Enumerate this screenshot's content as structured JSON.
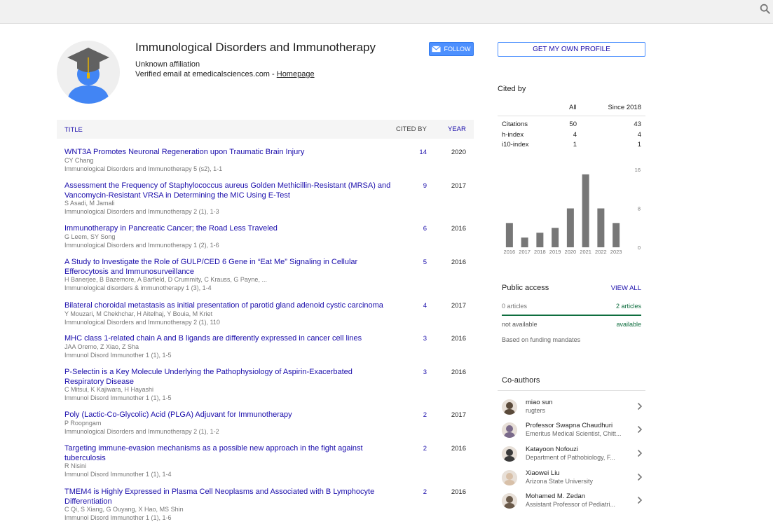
{
  "profile": {
    "name": "Immunological Disorders and Immunotherapy",
    "affiliation": "Unknown affiliation",
    "email_text": "Verified email at emedicalsciences.com - ",
    "homepage_link": "Homepage"
  },
  "buttons": {
    "follow": "FOLLOW",
    "get_profile": "GET MY OWN PROFILE"
  },
  "table": {
    "col_title": "TITLE",
    "col_cited": "CITED BY",
    "col_year": "YEAR",
    "rows": [
      {
        "title": "WNT3A Promotes Neuronal Regeneration upon Traumatic Brain Injury",
        "authors": "CY Chang",
        "venue": "Immunological Disorders and Immunotherapy 5 (s2), 1-1",
        "cited": "14",
        "year": "2020"
      },
      {
        "title": "Assessment the Frequency of Staphylococcus aureus Golden Methicillin-Resistant (MRSA) and Vancomycin-Resistant VRSA in Determining the MIC Using E-Test",
        "authors": "S Asadi, M Jamali",
        "venue": "Immunological Disorders and Immunotherapy 2 (1), 1-3",
        "cited": "9",
        "year": "2017"
      },
      {
        "title": "Immunotherapy in Pancreatic Cancer; the Road Less Traveled",
        "authors": "G Leem, SY Song",
        "venue": "Immunological Disorders and Immunotherapy 1 (2), 1-6",
        "cited": "6",
        "year": "2016"
      },
      {
        "title": "A Study to Investigate the Role of GULP/CED 6 Gene in “Eat Me” Signaling in Cellular Efferocytosis and Immunosurveillance",
        "authors": "H Banerjee, B Bazemore, A Barfield, D Crummity, C Krauss, G Payne, ...",
        "venue": "Immunological disorders & immunotherapy 1 (3), 1-4",
        "cited": "5",
        "year": "2016"
      },
      {
        "title": "Bilateral choroidal metastasis as initial presentation of parotid gland adenoid cystic carcinoma",
        "authors": "Y Mouzari, M Chekhchar, H Aitelhaj, Y Bouia, M Kriet",
        "venue": "Immunological Disorders and Immunotherapy 2 (1), 110",
        "cited": "4",
        "year": "2017"
      },
      {
        "title": "MHC class 1-related chain A and B ligands are differently expressed in cancer cell lines",
        "authors": "JAA Oremo, Z Xiao, Z Sha",
        "venue": "Immunol Disord Immunother 1 (1), 1-5",
        "cited": "3",
        "year": "2016"
      },
      {
        "title": "P-Selectin is a Key Molecule Underlying the Pathophysiology of Aspirin-Exacerbated Respiratory Disease",
        "authors": "C Mitsui, K Kajiwara, H Hayashi",
        "venue": "Immunol Disord Immunother 1 (1), 1-5",
        "cited": "3",
        "year": "2016"
      },
      {
        "title": "Poly (Lactic-Co-Glycolic) Acid (PLGA) Adjuvant for Immunotherapy",
        "authors": "P Roopngam",
        "venue": "Immunological Disorders and Immunotherapy 2 (1), 1-2",
        "cited": "2",
        "year": "2017"
      },
      {
        "title": "Targeting immune-evasion mechanisms as a possible new approach in the fight against tuberculosis",
        "authors": "R Nisini",
        "venue": "Immunol Disord Immunother 1 (1), 1-4",
        "cited": "2",
        "year": "2016"
      },
      {
        "title": "TMEM4 is Highly Expressed in Plasma Cell Neoplasms and Associated with B Lymphocyte Differentiation",
        "authors": "C Qi, S Xiang, G Ouyang, X Hao, MS Shin",
        "venue": "Immunol Disord Immunother 1 (1), 1-6",
        "cited": "2",
        "year": "2016"
      }
    ]
  },
  "cited_by": {
    "title": "Cited by",
    "col_all": "All",
    "col_since": "Since 2018",
    "rows": [
      {
        "label": "Citations",
        "all": "50",
        "since": "43"
      },
      {
        "label": "h-index",
        "all": "4",
        "since": "4"
      },
      {
        "label": "i10-index",
        "all": "1",
        "since": "1"
      }
    ]
  },
  "chart_data": {
    "type": "bar",
    "categories": [
      "2016",
      "2017",
      "2018",
      "2019",
      "2020",
      "2021",
      "2022",
      "2023"
    ],
    "values": [
      5,
      2,
      3,
      4,
      8,
      15,
      8,
      5
    ],
    "ylim": [
      0,
      16
    ],
    "yticks": [
      "16",
      "8",
      "0"
    ],
    "bar_color": "#777777"
  },
  "public_access": {
    "title": "Public access",
    "view_all": "VIEW ALL",
    "left_count": "0 articles",
    "right_count": "2 articles",
    "left_status": "not available",
    "right_status": "available",
    "note": "Based on funding mandates"
  },
  "coauthors": {
    "title": "Co-authors",
    "items": [
      {
        "name": "miao sun",
        "affiliation": "rugters"
      },
      {
        "name": "Professor Swapna Chaudhuri",
        "affiliation": "Emeritus Medical Scientist, Chitt..."
      },
      {
        "name": "Katayoon Nofouzi",
        "affiliation": "Department of Pathobiology, F..."
      },
      {
        "name": "Xiaowei Liu",
        "affiliation": "Arizona State University"
      },
      {
        "name": "Mohamed M. Zedan",
        "affiliation": "Assistant Professor of Pediatri..."
      }
    ]
  }
}
